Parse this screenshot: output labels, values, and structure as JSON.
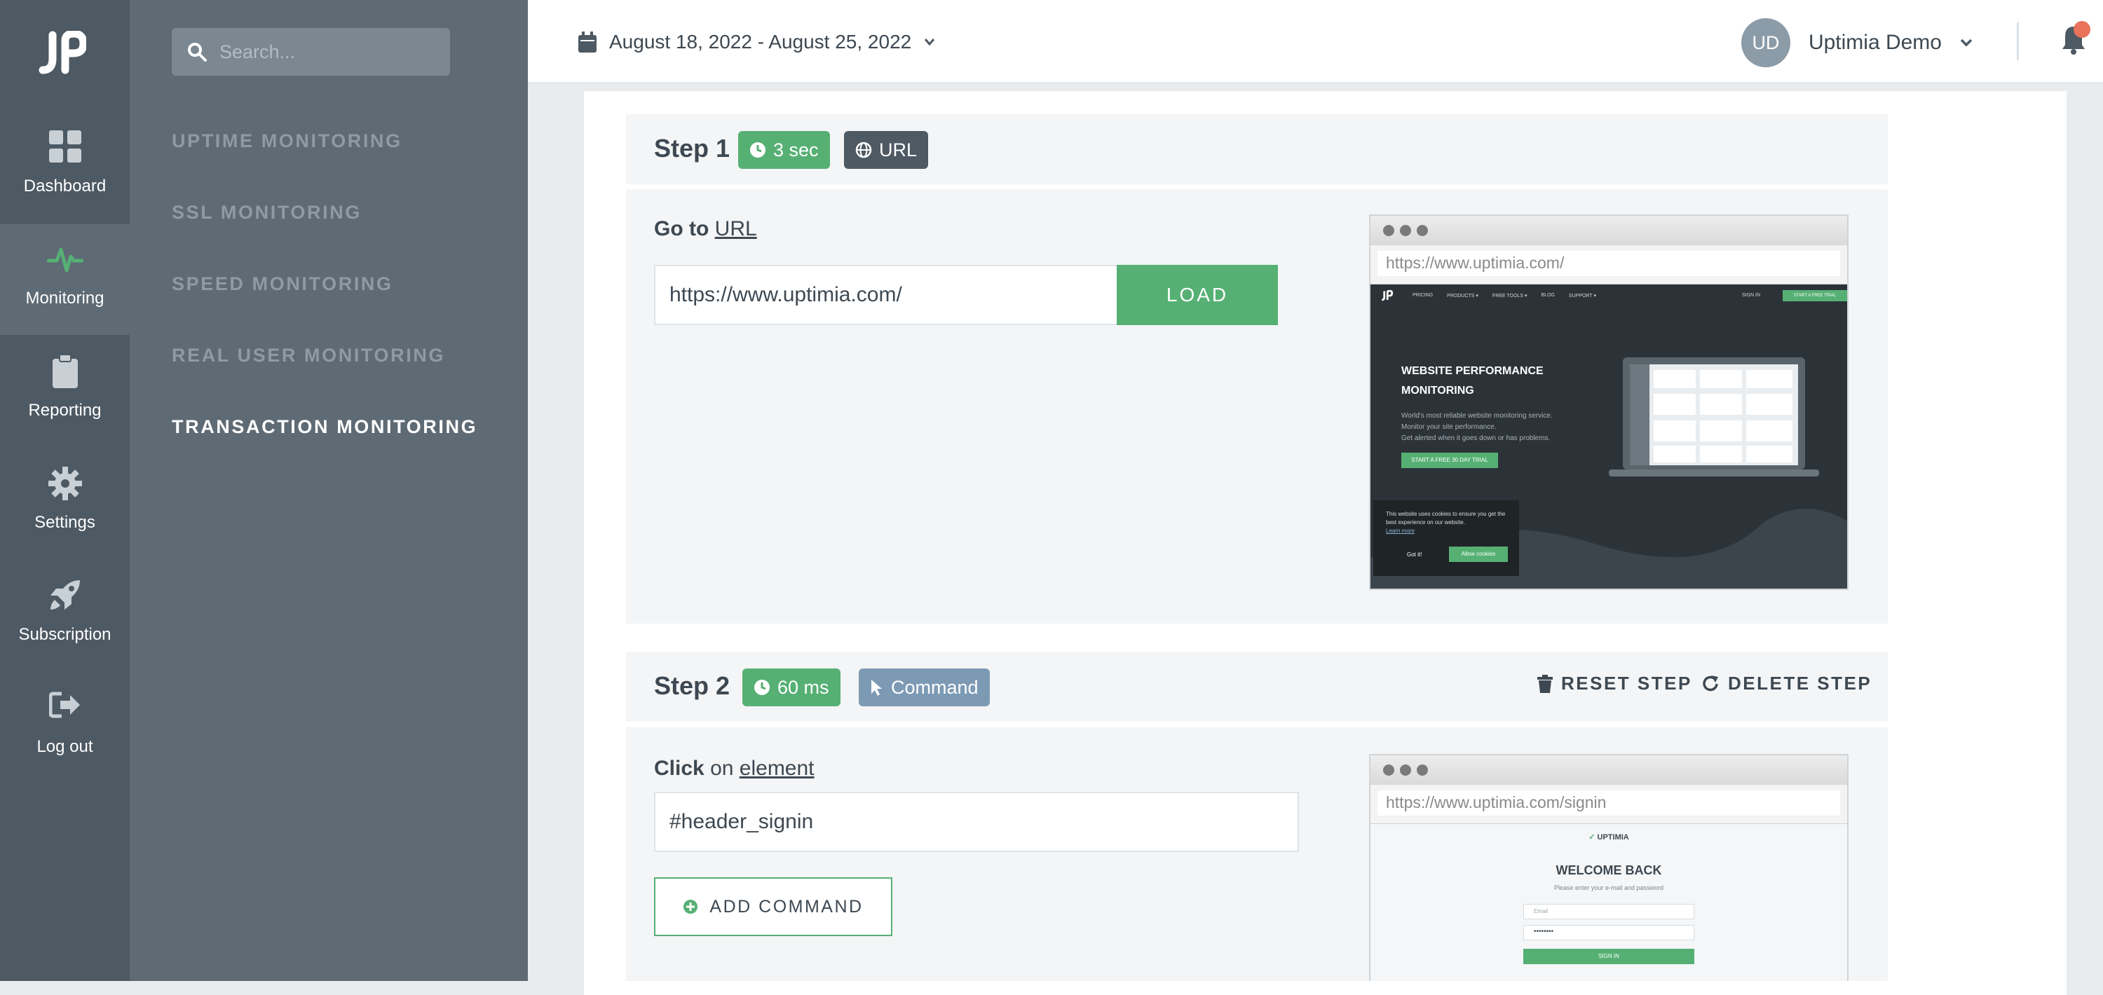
{
  "rail": {
    "items": [
      {
        "label": "Dashboard",
        "icon": "dashboard-icon"
      },
      {
        "label": "Monitoring",
        "icon": "pulse-icon"
      },
      {
        "label": "Reporting",
        "icon": "clipboard-icon"
      },
      {
        "label": "Settings",
        "icon": "gear-icon"
      },
      {
        "label": "Subscription",
        "icon": "rocket-icon"
      },
      {
        "label": "Log out",
        "icon": "logout-icon"
      }
    ]
  },
  "subnav": {
    "search_placeholder": "Search...",
    "items": [
      {
        "label": "UPTIME MONITORING"
      },
      {
        "label": "SSL MONITORING"
      },
      {
        "label": "SPEED MONITORING"
      },
      {
        "label": "REAL USER MONITORING"
      },
      {
        "label": "TRANSACTION MONITORING",
        "active": true
      }
    ]
  },
  "header": {
    "date_range": "August 18, 2022 - August 25, 2022",
    "user_initials": "UD",
    "user_name": "Uptimia Demo"
  },
  "colors": {
    "accent": "#56b074",
    "rail_bg": "#4d5963",
    "subnav_bg": "#5e6a74",
    "notification": "#e8735a"
  },
  "step1": {
    "title": "Step 1",
    "duration": "3 sec",
    "type": "URL",
    "action_verb": "Go to",
    "action_target": "URL",
    "url_value": "https://www.uptimia.com/",
    "load_label": "LOAD",
    "preview": {
      "address": "https://www.uptimia.com/",
      "nav_items": [
        "PRICING",
        "PRODUCTS ▾",
        "FREE TOOLS ▾",
        "BLOG",
        "SUPPORT ▾"
      ],
      "sign_in": "SIGN IN",
      "trial_button": "START A FREE TRIAL",
      "hero_line1": "WEBSITE PERFORMANCE",
      "hero_line2": "MONITORING",
      "sub_line1": "World's most reliable website monitoring service.",
      "sub_line2": "Monitor your site performance.",
      "sub_line3": "Get alerted when it goes down or has problems.",
      "cta": "START A FREE 30 DAY TRIAL",
      "cookie_text": "This website uses cookies to ensure you get the best experience on our website.",
      "cookie_link": "Learn more",
      "cookie_dismiss": "Got it!",
      "cookie_allow": "Allow cookies"
    }
  },
  "step2": {
    "title": "Step 2",
    "duration": "60 ms",
    "type": "Command",
    "reset_label": "RESET STEP",
    "delete_label": "DELETE STEP",
    "action_verb": "Click",
    "action_mid": "on",
    "action_target": "element",
    "selector_value": "#header_signin",
    "add_command_label": "ADD COMMAND",
    "preview": {
      "address": "https://www.uptimia.com/signin",
      "brand": "UPTIMIA",
      "heading": "WELCOME BACK",
      "subheading": "Please enter your e-mail and password",
      "email_placeholder": "Email",
      "password_mask": "••••••••",
      "submit": "SIGN IN"
    }
  }
}
